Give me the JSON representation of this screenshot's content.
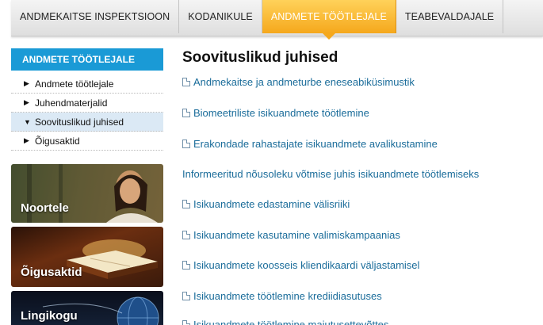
{
  "topnav": {
    "tabs": [
      {
        "label": "ANDMEKAITSE INSPEKTSIOON"
      },
      {
        "label": "KODANIKULE"
      },
      {
        "label": "ANDMETE TÖÖTLEJALE"
      },
      {
        "label": "TEABEVALDAJALE"
      }
    ],
    "active_index": 2
  },
  "sidebar": {
    "title": "ANDMETE TÖÖTLEJALE",
    "items": [
      {
        "label": "Andmete töötlejale",
        "arrow": "▶"
      },
      {
        "label": "Juhendmaterjalid",
        "arrow": "▶"
      },
      {
        "label": "Soovituslikud juhised",
        "arrow": "▼"
      },
      {
        "label": "Õigusaktid",
        "arrow": "▶"
      }
    ],
    "banners": [
      {
        "label": "Noortele"
      },
      {
        "label": "Õigusaktid"
      },
      {
        "label": "Lingikogu"
      }
    ]
  },
  "main": {
    "title": "Soovituslikud juhised",
    "links": [
      {
        "label": "Andmekaitse ja andmeturbe eneseabiküsimustik",
        "icon": "document-icon"
      },
      {
        "label": "Biomeetriliste isikuandmete töötlemine",
        "icon": "document-icon"
      },
      {
        "label": "Erakondade rahastajate isikuandmete avalikustamine",
        "icon": "document-icon"
      },
      {
        "label": "Informeeritud nõusoleku võtmise juhis isikuandmete töötlemiseks",
        "icon": ""
      },
      {
        "label": "Isikuandmete edastamine välisriiki",
        "icon": "document-icon"
      },
      {
        "label": "Isikuandmete kasutamine valimiskampaanias",
        "icon": "document-icon"
      },
      {
        "label": "Isikuandmete koosseis kliendikaardi väljastamisel",
        "icon": "document-icon"
      },
      {
        "label": "Isikuandmete töötlemine krediidiasutuses",
        "icon": "document-icon"
      },
      {
        "label": "Isikuandmete töötlemine maiutusettevõttes",
        "icon": "document-icon"
      }
    ]
  },
  "colors": {
    "accent_orange": "#f5a81c",
    "sidebar_blue": "#1a9ad6",
    "link_blue": "#1a6c9a"
  }
}
